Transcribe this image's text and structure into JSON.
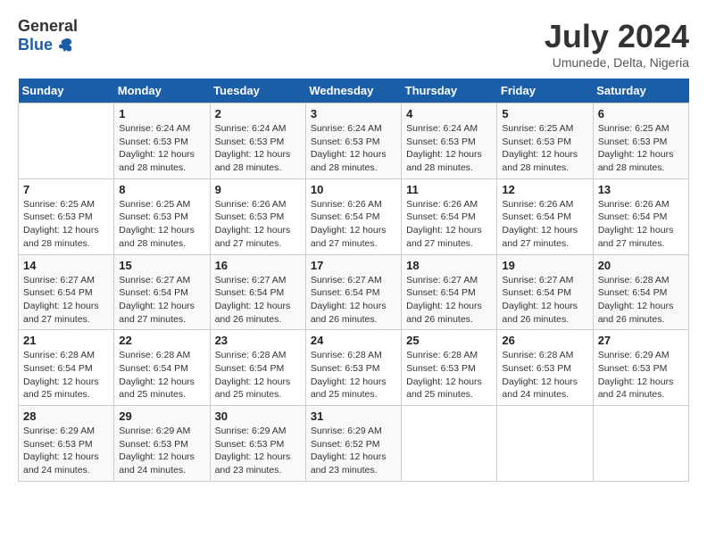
{
  "header": {
    "logo_general": "General",
    "logo_blue": "Blue",
    "title": "July 2024",
    "location": "Umunede, Delta, Nigeria"
  },
  "calendar": {
    "days_of_week": [
      "Sunday",
      "Monday",
      "Tuesday",
      "Wednesday",
      "Thursday",
      "Friday",
      "Saturday"
    ],
    "weeks": [
      [
        {
          "num": "",
          "info": ""
        },
        {
          "num": "1",
          "info": "Sunrise: 6:24 AM\nSunset: 6:53 PM\nDaylight: 12 hours\nand 28 minutes."
        },
        {
          "num": "2",
          "info": "Sunrise: 6:24 AM\nSunset: 6:53 PM\nDaylight: 12 hours\nand 28 minutes."
        },
        {
          "num": "3",
          "info": "Sunrise: 6:24 AM\nSunset: 6:53 PM\nDaylight: 12 hours\nand 28 minutes."
        },
        {
          "num": "4",
          "info": "Sunrise: 6:24 AM\nSunset: 6:53 PM\nDaylight: 12 hours\nand 28 minutes."
        },
        {
          "num": "5",
          "info": "Sunrise: 6:25 AM\nSunset: 6:53 PM\nDaylight: 12 hours\nand 28 minutes."
        },
        {
          "num": "6",
          "info": "Sunrise: 6:25 AM\nSunset: 6:53 PM\nDaylight: 12 hours\nand 28 minutes."
        }
      ],
      [
        {
          "num": "7",
          "info": "Sunrise: 6:25 AM\nSunset: 6:53 PM\nDaylight: 12 hours\nand 28 minutes."
        },
        {
          "num": "8",
          "info": "Sunrise: 6:25 AM\nSunset: 6:53 PM\nDaylight: 12 hours\nand 28 minutes."
        },
        {
          "num": "9",
          "info": "Sunrise: 6:26 AM\nSunset: 6:53 PM\nDaylight: 12 hours\nand 27 minutes."
        },
        {
          "num": "10",
          "info": "Sunrise: 6:26 AM\nSunset: 6:54 PM\nDaylight: 12 hours\nand 27 minutes."
        },
        {
          "num": "11",
          "info": "Sunrise: 6:26 AM\nSunset: 6:54 PM\nDaylight: 12 hours\nand 27 minutes."
        },
        {
          "num": "12",
          "info": "Sunrise: 6:26 AM\nSunset: 6:54 PM\nDaylight: 12 hours\nand 27 minutes."
        },
        {
          "num": "13",
          "info": "Sunrise: 6:26 AM\nSunset: 6:54 PM\nDaylight: 12 hours\nand 27 minutes."
        }
      ],
      [
        {
          "num": "14",
          "info": "Sunrise: 6:27 AM\nSunset: 6:54 PM\nDaylight: 12 hours\nand 27 minutes."
        },
        {
          "num": "15",
          "info": "Sunrise: 6:27 AM\nSunset: 6:54 PM\nDaylight: 12 hours\nand 27 minutes."
        },
        {
          "num": "16",
          "info": "Sunrise: 6:27 AM\nSunset: 6:54 PM\nDaylight: 12 hours\nand 26 minutes."
        },
        {
          "num": "17",
          "info": "Sunrise: 6:27 AM\nSunset: 6:54 PM\nDaylight: 12 hours\nand 26 minutes."
        },
        {
          "num": "18",
          "info": "Sunrise: 6:27 AM\nSunset: 6:54 PM\nDaylight: 12 hours\nand 26 minutes."
        },
        {
          "num": "19",
          "info": "Sunrise: 6:27 AM\nSunset: 6:54 PM\nDaylight: 12 hours\nand 26 minutes."
        },
        {
          "num": "20",
          "info": "Sunrise: 6:28 AM\nSunset: 6:54 PM\nDaylight: 12 hours\nand 26 minutes."
        }
      ],
      [
        {
          "num": "21",
          "info": "Sunrise: 6:28 AM\nSunset: 6:54 PM\nDaylight: 12 hours\nand 25 minutes."
        },
        {
          "num": "22",
          "info": "Sunrise: 6:28 AM\nSunset: 6:54 PM\nDaylight: 12 hours\nand 25 minutes."
        },
        {
          "num": "23",
          "info": "Sunrise: 6:28 AM\nSunset: 6:54 PM\nDaylight: 12 hours\nand 25 minutes."
        },
        {
          "num": "24",
          "info": "Sunrise: 6:28 AM\nSunset: 6:53 PM\nDaylight: 12 hours\nand 25 minutes."
        },
        {
          "num": "25",
          "info": "Sunrise: 6:28 AM\nSunset: 6:53 PM\nDaylight: 12 hours\nand 25 minutes."
        },
        {
          "num": "26",
          "info": "Sunrise: 6:28 AM\nSunset: 6:53 PM\nDaylight: 12 hours\nand 24 minutes."
        },
        {
          "num": "27",
          "info": "Sunrise: 6:29 AM\nSunset: 6:53 PM\nDaylight: 12 hours\nand 24 minutes."
        }
      ],
      [
        {
          "num": "28",
          "info": "Sunrise: 6:29 AM\nSunset: 6:53 PM\nDaylight: 12 hours\nand 24 minutes."
        },
        {
          "num": "29",
          "info": "Sunrise: 6:29 AM\nSunset: 6:53 PM\nDaylight: 12 hours\nand 24 minutes."
        },
        {
          "num": "30",
          "info": "Sunrise: 6:29 AM\nSunset: 6:53 PM\nDaylight: 12 hours\nand 23 minutes."
        },
        {
          "num": "31",
          "info": "Sunrise: 6:29 AM\nSunset: 6:52 PM\nDaylight: 12 hours\nand 23 minutes."
        },
        {
          "num": "",
          "info": ""
        },
        {
          "num": "",
          "info": ""
        },
        {
          "num": "",
          "info": ""
        }
      ]
    ]
  }
}
